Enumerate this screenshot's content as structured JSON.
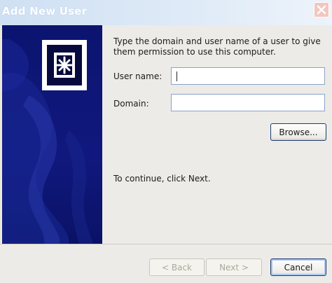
{
  "window": {
    "title": "Add New User"
  },
  "content": {
    "instructions": "Type the domain and user name of a user to give them permission to use this computer.",
    "username_label": "User name:",
    "username_value": "",
    "domain_label": "Domain:",
    "domain_value": "",
    "browse_label": "Browse...",
    "continue_text": "To continue, click Next."
  },
  "footer": {
    "back_label": "< Back",
    "next_label": "Next >",
    "cancel_label": "Cancel"
  },
  "icons": {
    "wizard": "user-key-icon",
    "close": "close-icon"
  },
  "colors": {
    "side_panel": "#10187e",
    "title_bar": "#dbe8f6",
    "accent_border": "#1d3a6e"
  }
}
